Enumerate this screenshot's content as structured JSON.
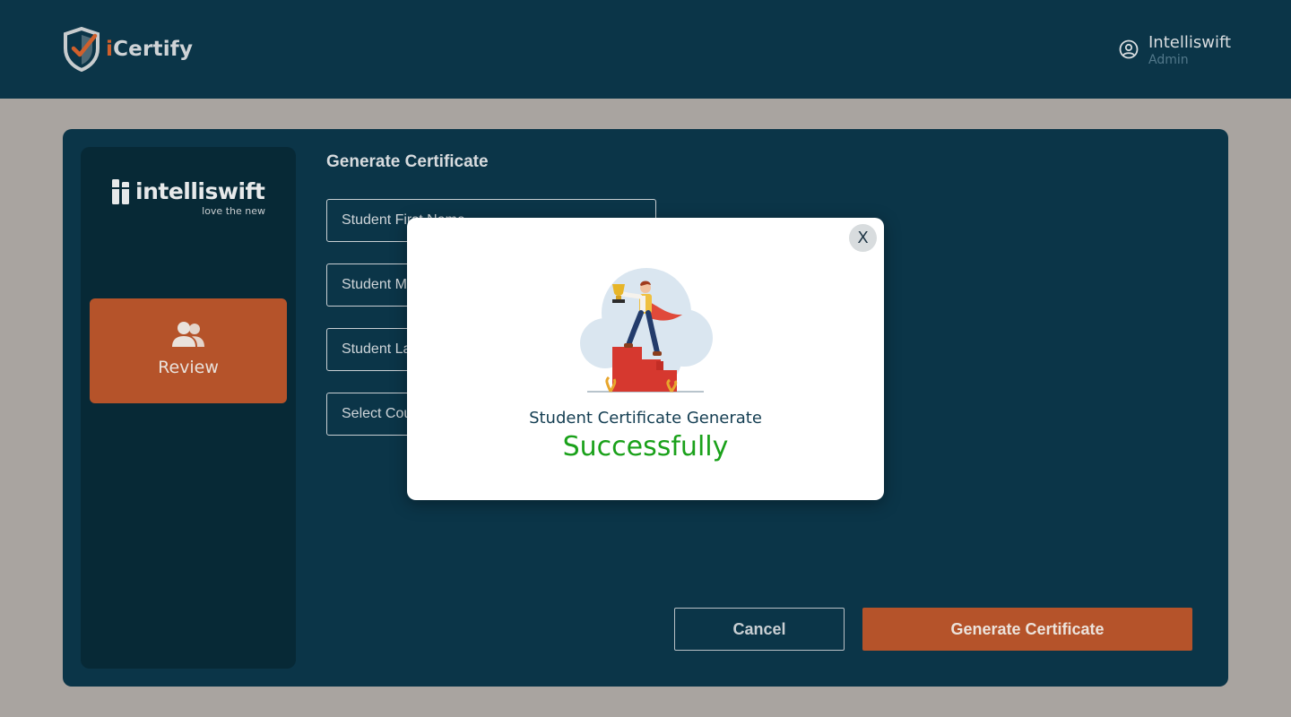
{
  "header": {
    "app_name_accent": "i",
    "app_name_rest": "Certify",
    "user_name": "Intelliswift",
    "user_role": "Admin"
  },
  "sidebar": {
    "logo_text": "intelliswift",
    "logo_tagline": "love the new",
    "items": [
      {
        "label": "Review",
        "icon": "users-icon"
      }
    ]
  },
  "form": {
    "title": "Generate Certificate",
    "fields": [
      {
        "placeholder": "Student First Name",
        "value": ""
      },
      {
        "placeholder": "Student Middle Name",
        "value": ""
      },
      {
        "placeholder": "Student Last Name",
        "value": ""
      },
      {
        "placeholder": "Select Course",
        "value": ""
      }
    ],
    "cancel_label": "Cancel",
    "generate_label": "Generate Certificate"
  },
  "modal": {
    "close_label": "X",
    "line1": "Student Certificate Generate",
    "line2": "Successfully"
  },
  "colors": {
    "header_bg": "#0b3548",
    "sidebar_bg": "#072936",
    "accent": "#b5532a",
    "success": "#1aa11a",
    "page_bg": "#a9a4a0"
  }
}
